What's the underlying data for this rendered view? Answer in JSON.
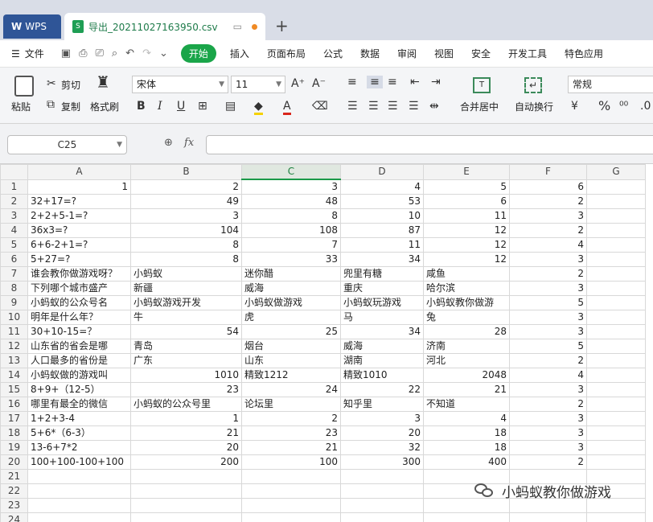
{
  "tabs": {
    "app": "WPS",
    "document": "导出_20211027163950.csv"
  },
  "menu": {
    "file": "文件",
    "start": "开始",
    "items": [
      "插入",
      "页面布局",
      "公式",
      "数据",
      "审阅",
      "视图",
      "安全",
      "开发工具",
      "特色应用"
    ]
  },
  "ribbon": {
    "paste": "粘贴",
    "cut": "剪切",
    "copy": "复制",
    "format_painter": "格式刷",
    "font_name": "宋体",
    "font_size": "11",
    "merge": "合并居中",
    "wrap": "自动换行",
    "number_format": "常规"
  },
  "formula_bar": {
    "cell_ref": "C25",
    "fx": "fx",
    "value": ""
  },
  "sheet": {
    "columns": [
      "A",
      "B",
      "C",
      "D",
      "E",
      "F",
      "G"
    ],
    "selected_column": "C",
    "rows": [
      {
        "n": "1",
        "cells": [
          [
            "1",
            "num"
          ],
          [
            "2",
            "num"
          ],
          [
            "3",
            "num"
          ],
          [
            "4",
            "num"
          ],
          [
            "5",
            "num"
          ],
          [
            "6",
            "num"
          ],
          [
            "",
            ""
          ]
        ]
      },
      {
        "n": "2",
        "cells": [
          [
            "32+17=?",
            "txt"
          ],
          [
            "49",
            "num"
          ],
          [
            "48",
            "num"
          ],
          [
            "53",
            "num"
          ],
          [
            "6",
            "num"
          ],
          [
            "2",
            "num"
          ],
          [
            "",
            ""
          ]
        ]
      },
      {
        "n": "3",
        "cells": [
          [
            "2+2+5-1=?",
            "txt"
          ],
          [
            "3",
            "num"
          ],
          [
            "8",
            "num"
          ],
          [
            "10",
            "num"
          ],
          [
            "11",
            "num"
          ],
          [
            "3",
            "num"
          ],
          [
            "",
            ""
          ]
        ]
      },
      {
        "n": "4",
        "cells": [
          [
            "36x3=?",
            "txt"
          ],
          [
            "104",
            "num"
          ],
          [
            "108",
            "num"
          ],
          [
            "87",
            "num"
          ],
          [
            "12",
            "num"
          ],
          [
            "2",
            "num"
          ],
          [
            "",
            ""
          ]
        ]
      },
      {
        "n": "5",
        "cells": [
          [
            "6+6-2+1=?",
            "txt"
          ],
          [
            "8",
            "num"
          ],
          [
            "7",
            "num"
          ],
          [
            "11",
            "num"
          ],
          [
            "12",
            "num"
          ],
          [
            "4",
            "num"
          ],
          [
            "",
            ""
          ]
        ]
      },
      {
        "n": "6",
        "cells": [
          [
            "5+27=?",
            "txt"
          ],
          [
            "8",
            "num"
          ],
          [
            "33",
            "num"
          ],
          [
            "34",
            "num"
          ],
          [
            "12",
            "num"
          ],
          [
            "3",
            "num"
          ],
          [
            "",
            ""
          ]
        ]
      },
      {
        "n": "7",
        "cells": [
          [
            "谁会教你做游戏呀？",
            "txt"
          ],
          [
            "小蚂蚁",
            "txt"
          ],
          [
            "迷你醋",
            "txt"
          ],
          [
            "兜里有糖",
            "txt"
          ],
          [
            "咸鱼",
            "txt"
          ],
          [
            "2",
            "num"
          ],
          [
            "",
            ""
          ]
        ]
      },
      {
        "n": "8",
        "cells": [
          [
            "下列哪个城市盛产",
            "txt"
          ],
          [
            "新疆",
            "txt"
          ],
          [
            "威海",
            "txt"
          ],
          [
            "重庆",
            "txt"
          ],
          [
            "哈尔滨",
            "txt"
          ],
          [
            "3",
            "num"
          ],
          [
            "",
            ""
          ]
        ]
      },
      {
        "n": "9",
        "cells": [
          [
            "小蚂蚁的公众号名",
            "txt"
          ],
          [
            "小蚂蚁游戏开发",
            "txt"
          ],
          [
            "小蚂蚁做游戏",
            "txt"
          ],
          [
            "小蚂蚁玩游戏",
            "txt"
          ],
          [
            "小蚂蚁教你做游",
            "txt"
          ],
          [
            "5",
            "num"
          ],
          [
            "",
            ""
          ]
        ]
      },
      {
        "n": "10",
        "cells": [
          [
            "明年是什么年？",
            "txt"
          ],
          [
            "牛",
            "txt"
          ],
          [
            "虎",
            "txt"
          ],
          [
            "马",
            "txt"
          ],
          [
            "兔",
            "txt"
          ],
          [
            "3",
            "num"
          ],
          [
            "",
            ""
          ]
        ]
      },
      {
        "n": "11",
        "cells": [
          [
            "30+10-15=？",
            "txt"
          ],
          [
            "54",
            "num"
          ],
          [
            "25",
            "num"
          ],
          [
            "34",
            "num"
          ],
          [
            "28",
            "num"
          ],
          [
            "3",
            "num"
          ],
          [
            "",
            ""
          ]
        ]
      },
      {
        "n": "12",
        "cells": [
          [
            "山东省的省会是哪",
            "txt"
          ],
          [
            "青岛",
            "txt"
          ],
          [
            "烟台",
            "txt"
          ],
          [
            "威海",
            "txt"
          ],
          [
            "济南",
            "txt"
          ],
          [
            "5",
            "num"
          ],
          [
            "",
            ""
          ]
        ]
      },
      {
        "n": "13",
        "cells": [
          [
            "人口最多的省份是",
            "txt"
          ],
          [
            "广东",
            "txt"
          ],
          [
            "山东",
            "txt"
          ],
          [
            "湖南",
            "txt"
          ],
          [
            "河北",
            "txt"
          ],
          [
            "2",
            "num"
          ],
          [
            "",
            ""
          ]
        ]
      },
      {
        "n": "14",
        "cells": [
          [
            "小蚂蚁做的游戏叫",
            "txt"
          ],
          [
            "1010",
            "num"
          ],
          [
            "精致1212",
            "txt"
          ],
          [
            "精致1010",
            "txt"
          ],
          [
            "2048",
            "num"
          ],
          [
            "4",
            "num"
          ],
          [
            "",
            ""
          ]
        ]
      },
      {
        "n": "15",
        "cells": [
          [
            "8+9+（12-5）",
            "txt"
          ],
          [
            "23",
            "num"
          ],
          [
            "24",
            "num"
          ],
          [
            "22",
            "num"
          ],
          [
            "21",
            "num"
          ],
          [
            "3",
            "num"
          ],
          [
            "",
            ""
          ]
        ]
      },
      {
        "n": "16",
        "cells": [
          [
            "哪里有最全的微信",
            "txt"
          ],
          [
            "小蚂蚁的公众号里",
            "txt"
          ],
          [
            "论坛里",
            "txt"
          ],
          [
            "知乎里",
            "txt"
          ],
          [
            "不知道",
            "txt"
          ],
          [
            "2",
            "num"
          ],
          [
            "",
            ""
          ]
        ]
      },
      {
        "n": "17",
        "cells": [
          [
            "1+2+3-4",
            "txt"
          ],
          [
            "1",
            "num"
          ],
          [
            "2",
            "num"
          ],
          [
            "3",
            "num"
          ],
          [
            "4",
            "num"
          ],
          [
            "3",
            "num"
          ],
          [
            "",
            ""
          ]
        ]
      },
      {
        "n": "18",
        "cells": [
          [
            "5+6*（6-3）",
            "txt"
          ],
          [
            "21",
            "num"
          ],
          [
            "23",
            "num"
          ],
          [
            "20",
            "num"
          ],
          [
            "18",
            "num"
          ],
          [
            "3",
            "num"
          ],
          [
            "",
            ""
          ]
        ]
      },
      {
        "n": "19",
        "cells": [
          [
            "13-6+7*2",
            "txt"
          ],
          [
            "20",
            "num"
          ],
          [
            "21",
            "num"
          ],
          [
            "32",
            "num"
          ],
          [
            "18",
            "num"
          ],
          [
            "3",
            "num"
          ],
          [
            "",
            ""
          ]
        ]
      },
      {
        "n": "20",
        "cells": [
          [
            "100+100-100+100",
            "txt"
          ],
          [
            "200",
            "num"
          ],
          [
            "100",
            "num"
          ],
          [
            "300",
            "num"
          ],
          [
            "400",
            "num"
          ],
          [
            "2",
            "num"
          ],
          [
            "",
            ""
          ]
        ]
      },
      {
        "n": "21",
        "cells": [
          [
            "",
            ""
          ],
          [
            "",
            ""
          ],
          [
            "",
            ""
          ],
          [
            "",
            ""
          ],
          [
            "",
            ""
          ],
          [
            "",
            ""
          ],
          [
            "",
            ""
          ]
        ]
      },
      {
        "n": "22",
        "cells": [
          [
            "",
            ""
          ],
          [
            "",
            ""
          ],
          [
            "",
            ""
          ],
          [
            "",
            ""
          ],
          [
            "",
            ""
          ],
          [
            "",
            ""
          ],
          [
            "",
            ""
          ]
        ]
      },
      {
        "n": "23",
        "cells": [
          [
            "",
            ""
          ],
          [
            "",
            ""
          ],
          [
            "",
            ""
          ],
          [
            "",
            ""
          ],
          [
            "",
            ""
          ],
          [
            "",
            ""
          ],
          [
            "",
            ""
          ]
        ]
      },
      {
        "n": "24",
        "cells": [
          [
            "",
            ""
          ],
          [
            "",
            ""
          ],
          [
            "",
            ""
          ],
          [
            "",
            ""
          ],
          [
            "",
            ""
          ],
          [
            "",
            ""
          ],
          [
            "",
            ""
          ]
        ]
      }
    ]
  },
  "watermark": "小蚂蚁教你做游戏",
  "colors": {
    "accent": "#1aa549",
    "app_tab": "#2f5597"
  }
}
